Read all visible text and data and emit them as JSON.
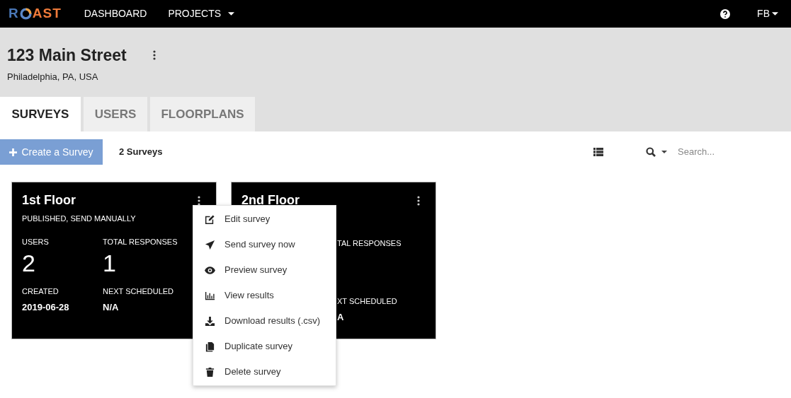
{
  "nav": {
    "logo": {
      "before": "R",
      "after": "AST"
    },
    "links": [
      {
        "label": "DASHBOARD",
        "dropdown": false
      },
      {
        "label": "PROJECTS",
        "dropdown": true
      }
    ],
    "user": "FB"
  },
  "header": {
    "title": "123 Main Street",
    "subtitle": "Philadelphia, PA, USA"
  },
  "tabs": [
    {
      "label": "SURVEYS",
      "selected": true
    },
    {
      "label": "USERS",
      "selected": false
    },
    {
      "label": "FLOORPLANS",
      "selected": false
    }
  ],
  "toolbar": {
    "create_button": "Create a Survey",
    "count": "2 Surveys",
    "search": {
      "placeholder": "Search..."
    }
  },
  "cards": [
    {
      "title": "1st Floor",
      "status": "PUBLISHED, SEND MANUALLY",
      "users_label": "USERS",
      "users": "2",
      "responses_label": "TOTAL RESPONSES",
      "responses": "1",
      "created_label": "CREATED",
      "created": "2019-06-28",
      "next_label": "NEXT SCHEDULED",
      "next": "N/A"
    },
    {
      "title": "2nd Floor",
      "responses_label": "TAL RESPONSES",
      "next_label": "XT SCHEDULED",
      "next": "A"
    }
  ],
  "menu": {
    "items": [
      {
        "kind": "edit",
        "label": "Edit survey"
      },
      {
        "kind": "send",
        "label": "Send survey now"
      },
      {
        "kind": "preview",
        "label": "Preview survey"
      },
      {
        "kind": "results",
        "label": "View results"
      },
      {
        "kind": "download",
        "label": "Download results (.csv)"
      },
      {
        "kind": "duplicate",
        "label": "Duplicate survey"
      },
      {
        "kind": "delete",
        "label": "Delete survey"
      }
    ]
  }
}
